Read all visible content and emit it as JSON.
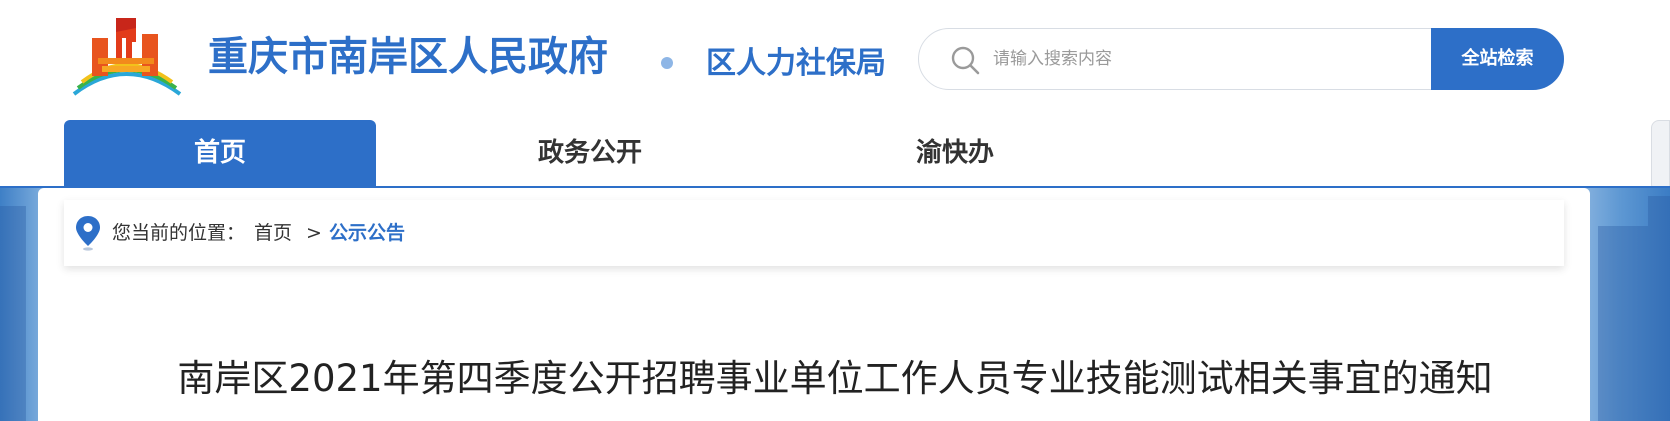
{
  "header": {
    "site_title": "重庆市南岸区人民政府",
    "department": "区人力社保局"
  },
  "search": {
    "placeholder": "请输入搜索内容",
    "button_label": "全站检索"
  },
  "nav": {
    "items": [
      {
        "label": "首页",
        "active": true
      },
      {
        "label": "政务公开",
        "active": false
      },
      {
        "label": "渝快办",
        "active": false
      }
    ]
  },
  "breadcrumb": {
    "prefix": "您当前的位置：",
    "home": "首页",
    "separator": ">",
    "current": "公示公告"
  },
  "article": {
    "title": "南岸区2021年第四季度公开招聘事业单位工作人员专业技能测试相关事宜的通知"
  },
  "colors": {
    "accent": "#2d6fc8",
    "text": "#333333"
  }
}
